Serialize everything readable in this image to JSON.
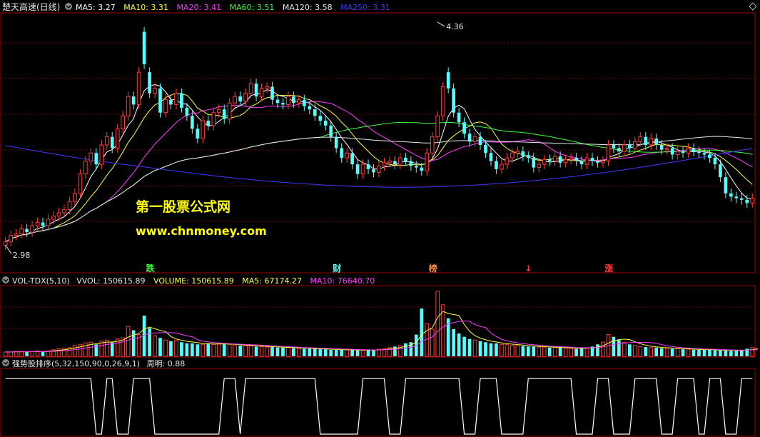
{
  "colors": {
    "up": "#ff3b3b",
    "down": "#54ffff",
    "ma5": "#ffffff",
    "ma10": "#ffff3a",
    "ma20": "#ff3bff",
    "ma60": "#3bff3b",
    "ma120": "#e6e6e6",
    "ma250": "#3b3bff",
    "grid": "#7a0000",
    "border": "#a00000",
    "watermark": "#ffff00",
    "signal_line": "#ffffff"
  },
  "price_panel": {
    "stock_name": "楚天高速(日线)",
    "indicators": [
      {
        "label": "MA5: 3.27",
        "color": "#ffffff"
      },
      {
        "label": "MA10: 3.31",
        "color": "#ffff3a"
      },
      {
        "label": "MA20: 3.41",
        "color": "#ff3bff"
      },
      {
        "label": "MA60: 3.51",
        "color": "#3bff3b"
      },
      {
        "label": "MA120: 3.58",
        "color": "#e6e6e6"
      },
      {
        "label": "MA250: 3.31",
        "color": "#3b3bff"
      }
    ],
    "high_label": "4.36",
    "low_label": "2.98",
    "markers": [
      {
        "text": "跌",
        "color": "#3bff3b",
        "index": 27
      },
      {
        "text": "财",
        "color": "#54ffff",
        "index": 62
      },
      {
        "text": "榜",
        "color": "#ff8a3b",
        "index": 80
      },
      {
        "text": "↓",
        "color": "#ff3b3b",
        "index": 98
      },
      {
        "text": "涨",
        "color": "#ff3b3b",
        "index": 113
      }
    ]
  },
  "watermark": {
    "line1": "第一股票公式网",
    "line2": "www.chnmoney.com"
  },
  "volume_panel": {
    "indicator_name": "VOL-TDX(5,10)",
    "vvol": "VVOL: 150615.89",
    "volume": "VOLUME: 150615.89",
    "ma5": "MA5: 67174.27",
    "ma10": "MA10: 76640.70"
  },
  "signal_panel": {
    "indicator_name": "强势股排序(5,32,150,90,0,26,9,1)",
    "value": "周明: 0.88"
  },
  "chart_data": [
    {
      "type": "candlestick",
      "name": "price",
      "close": [
        3.0,
        3.04,
        3.05,
        3.08,
        3.06,
        3.1,
        3.12,
        3.1,
        3.14,
        3.16,
        3.18,
        3.2,
        3.25,
        3.3,
        3.42,
        3.5,
        3.55,
        3.48,
        3.6,
        3.65,
        3.58,
        3.7,
        3.78,
        3.9,
        3.85,
        4.05,
        4.1,
        3.92,
        3.95,
        3.8,
        3.88,
        3.85,
        3.92,
        3.83,
        3.78,
        3.7,
        3.64,
        3.75,
        3.72,
        3.8,
        3.82,
        3.76,
        3.86,
        3.9,
        3.87,
        3.92,
        3.98,
        3.9,
        3.95,
        3.96,
        3.88,
        3.86,
        3.85,
        3.9,
        3.86,
        3.88,
        3.84,
        3.82,
        3.78,
        3.75,
        3.72,
        3.65,
        3.58,
        3.52,
        3.55,
        3.48,
        3.42,
        3.48,
        3.45,
        3.43,
        3.47,
        3.49,
        3.5,
        3.48,
        3.52,
        3.5,
        3.47,
        3.46,
        3.44,
        3.55,
        3.65,
        3.78,
        3.96,
        3.95,
        3.8,
        3.74,
        3.67,
        3.62,
        3.65,
        3.6,
        3.55,
        3.5,
        3.45,
        3.48,
        3.52,
        3.55,
        3.56,
        3.53,
        3.52,
        3.46,
        3.48,
        3.51,
        3.5,
        3.53,
        3.49,
        3.51,
        3.52,
        3.5,
        3.48,
        3.52,
        3.5,
        3.49,
        3.5,
        3.6,
        3.58,
        3.56,
        3.6,
        3.58,
        3.62,
        3.65,
        3.6,
        3.64,
        3.6,
        3.57,
        3.58,
        3.54,
        3.56,
        3.55,
        3.58,
        3.56,
        3.55,
        3.54,
        3.52,
        3.48,
        3.4,
        3.3,
        3.28,
        3.27,
        3.26,
        3.24,
        3.27
      ],
      "open": [
        2.98,
        3.0,
        3.04,
        3.05,
        3.08,
        3.06,
        3.1,
        3.12,
        3.1,
        3.14,
        3.16,
        3.18,
        3.2,
        3.25,
        3.3,
        3.42,
        3.5,
        3.55,
        3.48,
        3.6,
        3.65,
        3.58,
        3.7,
        3.78,
        3.9,
        3.85,
        4.3,
        4.05,
        3.92,
        3.95,
        3.8,
        3.88,
        3.85,
        3.92,
        3.83,
        3.78,
        3.7,
        3.64,
        3.75,
        3.72,
        3.8,
        3.82,
        3.76,
        3.86,
        3.9,
        3.87,
        3.92,
        3.98,
        3.9,
        3.95,
        3.96,
        3.88,
        3.86,
        3.85,
        3.9,
        3.86,
        3.88,
        3.84,
        3.82,
        3.78,
        3.75,
        3.72,
        3.65,
        3.58,
        3.52,
        3.55,
        3.48,
        3.42,
        3.48,
        3.45,
        3.43,
        3.47,
        3.49,
        3.5,
        3.48,
        3.52,
        3.5,
        3.47,
        3.46,
        3.44,
        3.55,
        3.65,
        3.78,
        4.05,
        3.95,
        3.8,
        3.74,
        3.67,
        3.62,
        3.65,
        3.6,
        3.55,
        3.5,
        3.45,
        3.48,
        3.52,
        3.55,
        3.56,
        3.53,
        3.52,
        3.46,
        3.48,
        3.51,
        3.5,
        3.53,
        3.49,
        3.51,
        3.52,
        3.5,
        3.48,
        3.52,
        3.5,
        3.49,
        3.5,
        3.6,
        3.58,
        3.56,
        3.6,
        3.58,
        3.62,
        3.65,
        3.6,
        3.64,
        3.6,
        3.57,
        3.58,
        3.54,
        3.56,
        3.55,
        3.58,
        3.56,
        3.55,
        3.54,
        3.52,
        3.48,
        3.4,
        3.3,
        3.28,
        3.27,
        3.26,
        3.24
      ],
      "high_mark": 4.36,
      "low_mark": 2.98,
      "ylim": [
        2.95,
        4.4
      ]
    },
    {
      "type": "bar",
      "name": "volume",
      "values": [
        8,
        8,
        9,
        9,
        8,
        9,
        10,
        9,
        10,
        12,
        14,
        15,
        16,
        20,
        22,
        25,
        26,
        22,
        28,
        30,
        26,
        32,
        34,
        55,
        48,
        40,
        75,
        52,
        38,
        34,
        30,
        28,
        30,
        26,
        24,
        24,
        22,
        22,
        24,
        22,
        24,
        22,
        22,
        20,
        20,
        20,
        19,
        18,
        18,
        17,
        17,
        16,
        16,
        16,
        15,
        15,
        14,
        14,
        14,
        13,
        13,
        12,
        12,
        12,
        12,
        12,
        11,
        11,
        12,
        12,
        13,
        14,
        16,
        18,
        20,
        24,
        26,
        40,
        88,
        60,
        50,
        120,
        95,
        70,
        50,
        42,
        36,
        32,
        30,
        28,
        26,
        24,
        24,
        22,
        22,
        20,
        20,
        19,
        18,
        18,
        17,
        17,
        16,
        16,
        16,
        15,
        15,
        14,
        15,
        16,
        18,
        22,
        26,
        40,
        36,
        30,
        26,
        22,
        20,
        18,
        17,
        16,
        16,
        15,
        15,
        14,
        14,
        13,
        13,
        12,
        12,
        12,
        12,
        11,
        11,
        11,
        10,
        10,
        12,
        14,
        16,
        18
      ],
      "ylim": [
        0,
        125
      ]
    },
    {
      "type": "line",
      "name": "signal",
      "values": [
        0.88,
        0.88,
        0.88,
        0.88,
        0.88,
        0.88,
        0.88,
        0.88,
        0.88,
        0.88,
        0.88,
        0.88,
        0.88,
        0.88,
        0.88,
        0.88,
        0.88,
        0.0,
        0.0,
        0.88,
        0.88,
        0.0,
        0.0,
        0.0,
        0.88,
        0.88,
        0.88,
        0.88,
        0.0,
        0.0,
        0.0,
        0.0,
        0.0,
        0.0,
        0.0,
        0.0,
        0.0,
        0.0,
        0.0,
        0.0,
        0.0,
        0.88,
        0.88,
        0.88,
        0.0,
        0.88,
        0.88,
        0.88,
        0.88,
        0.88,
        0.88,
        0.88,
        0.88,
        0.88,
        0.88,
        0.88,
        0.88,
        0.88,
        0.88,
        0.0,
        0.0,
        0.0,
        0.0,
        0.0,
        0.0,
        0.0,
        0.0,
        0.88,
        0.88,
        0.88,
        0.88,
        0.88,
        0.0,
        0.0,
        0.0,
        0.88,
        0.88,
        0.88,
        0.88,
        0.88,
        0.88,
        0.88,
        0.88,
        0.88,
        0.88,
        0.88,
        0.0,
        0.0,
        0.0,
        0.88,
        0.88,
        0.88,
        0.88,
        0.0,
        0.0,
        0.0,
        0.0,
        0.0,
        0.88,
        0.88,
        0.88,
        0.88,
        0.88,
        0.88,
        0.88,
        0.88,
        0.88,
        0.0,
        0.0,
        0.0,
        0.0,
        0.88,
        0.88,
        0.88,
        0.0,
        0.0,
        0.0,
        0.0,
        0.88,
        0.88,
        0.88,
        0.88,
        0.88,
        0.0,
        0.0,
        0.0,
        0.88,
        0.88,
        0.88,
        0.88,
        0.0,
        0.0,
        0.88,
        0.88,
        0.88,
        0.0,
        0.0,
        0.0,
        0.88,
        0.88,
        0.88
      ],
      "ylim": [
        0,
        1
      ]
    }
  ]
}
